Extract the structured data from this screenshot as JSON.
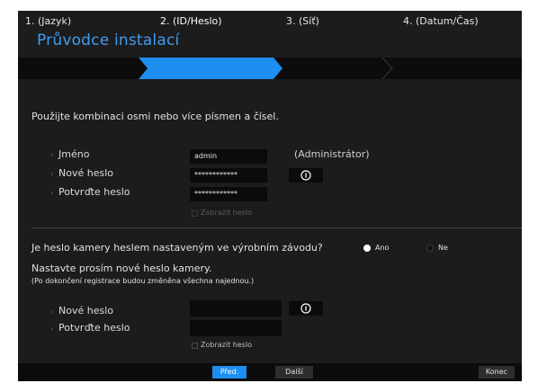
{
  "wizard": {
    "title": "Průvodce instalací"
  },
  "steps": [
    {
      "label": "1. (Jazyk)"
    },
    {
      "label": "2. (ID/Heslo)"
    },
    {
      "label": "3. (Síť)"
    },
    {
      "label": "4. (Datum/Čas)"
    }
  ],
  "section1": {
    "hint": "Použijte kombinaci osmi nebo více písmen a čísel.",
    "name_label": "Jméno",
    "name_value": "admin",
    "name_note": "(Administrátor)",
    "new_password_label": "Nové heslo",
    "new_password_value": "************",
    "confirm_password_label": "Potvrďte heslo",
    "confirm_password_value": "************",
    "show_password_label": "Zobrazit heslo"
  },
  "section2": {
    "question": "Je heslo kamery heslem nastaveným ve výrobním závodu?",
    "yes_label": "Ano",
    "no_label": "Ne",
    "instruction": "Nastavte prosím nové heslo kamery.",
    "note": "(Po dokončení registrace budou změněna všechna najednou.)",
    "new_password_label": "Nové heslo",
    "confirm_password_label": "Potvrďte heslo",
    "show_password_label": "Zobrazit heslo"
  },
  "footer": {
    "prev_label": "Před.",
    "next_label": "Další",
    "finish_label": "Konec"
  },
  "icons": {
    "bullet": "›",
    "info": "ⓘ"
  },
  "colors": {
    "accent": "#3f9cf1",
    "active_step": "#1e8ef0",
    "background": "#1c1c1c"
  }
}
